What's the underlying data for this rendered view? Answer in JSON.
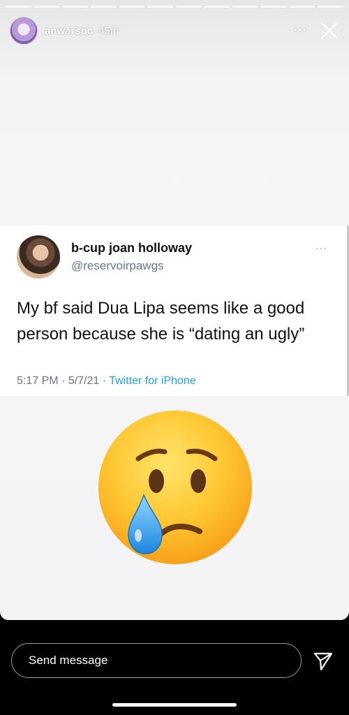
{
  "story": {
    "username": "anwarspc",
    "time_ago": "45m",
    "more_label": "···",
    "progress_segments": 12
  },
  "tweet": {
    "display_name": "b-cup joan holloway",
    "handle": "@reservoirpawgs",
    "more_label": "···",
    "text": "My bf said Dua Lipa seems like a good person because she is “dating an ugly”",
    "time": "5:17 PM",
    "date": "5/7/21",
    "source": "Twitter for iPhone",
    "separator": " · "
  },
  "emoji": {
    "icon": "crying-face-emoji"
  },
  "footer": {
    "message_placeholder": "Send message",
    "send_icon": "paper-plane-icon"
  }
}
